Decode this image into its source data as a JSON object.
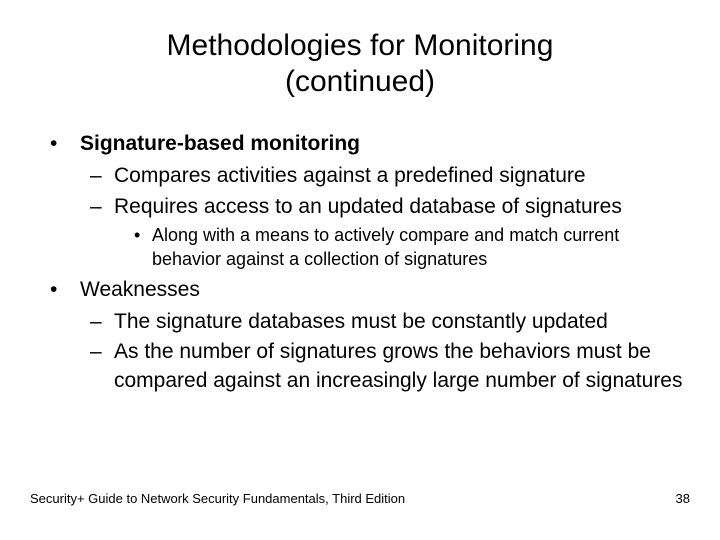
{
  "title_line1": "Methodologies for Monitoring",
  "title_line2": "(continued)",
  "bullets": {
    "l1_1": "Signature-based monitoring",
    "l2_1": "Compares activities against a predefined signature",
    "l2_2": "Requires access to an updated database of signatures",
    "l3_1": "Along with a means to actively compare and match current behavior against a collection of signatures",
    "l1_2": "Weaknesses",
    "l2_3": "The signature databases must be constantly updated",
    "l2_4": "As the number of signatures grows the behaviors must be compared against an increasingly large number of signatures"
  },
  "footer_left": "Security+ Guide to Network Security Fundamentals, Third Edition",
  "footer_right": "38"
}
